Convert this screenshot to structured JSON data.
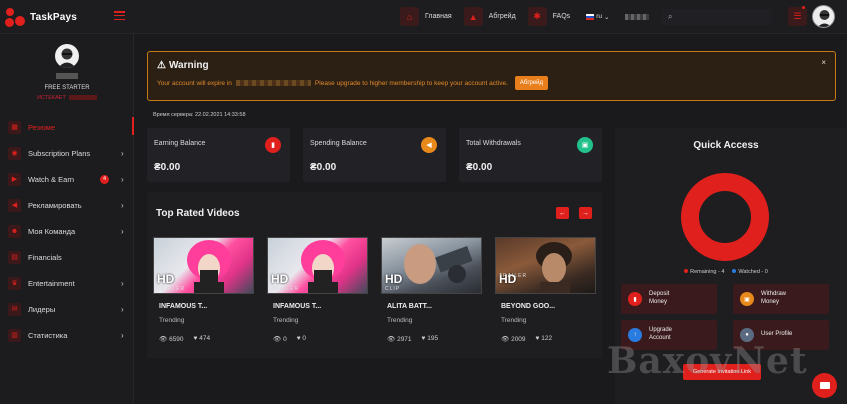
{
  "brand": {
    "name": "TaskPays"
  },
  "nav": {
    "items": [
      {
        "label": "Главная",
        "icon": "home-icon"
      },
      {
        "label": "Абгрейд",
        "icon": "upgrade-icon"
      },
      {
        "label": "FAQs",
        "icon": "faq-icon"
      }
    ],
    "language": "ru"
  },
  "profile": {
    "plan": "FREE STARTER",
    "expiry_label": "ИСТЕКАЕТ"
  },
  "sidebar": {
    "items": [
      {
        "label": "Резюме",
        "active": true
      },
      {
        "label": "Subscription Plans",
        "chevron": "›"
      },
      {
        "label": "Watch & Earn",
        "badge": "4",
        "chevron": "›"
      },
      {
        "label": "Рекламировать",
        "chevron": "›"
      },
      {
        "label": "Моя Команда",
        "chevron": "›"
      },
      {
        "label": "Financials"
      },
      {
        "label": "Entertainment",
        "chevron": "›"
      },
      {
        "label": "Лидеры",
        "chevron": "›"
      },
      {
        "label": "Статистика",
        "chevron": "›"
      }
    ]
  },
  "warning": {
    "title": "Warning",
    "text_before": "Your account will expire in",
    "text_after": "Please upgrade to higher membership to keep your account active.",
    "button": "Абгрейд",
    "close": "×"
  },
  "server_time": "Время сервера: 22.02.2021 14:33:58",
  "balances": [
    {
      "label": "Earning Balance",
      "value": "₴0.00",
      "icon_color": "#e0201c"
    },
    {
      "label": "Spending Balance",
      "value": "₴0.00",
      "icon_color": "#e8891c"
    },
    {
      "label": "Total Withdrawals",
      "value": "₴0.00",
      "icon_color": "#22c08a"
    }
  ],
  "top_rated": {
    "title": "Top Rated Videos",
    "prev": "←",
    "next": "→",
    "videos": [
      {
        "title": "INFAMOUS T...",
        "tag": "Trending",
        "views": "6590",
        "likes": "474",
        "badge": "HD",
        "sub": "TRAILER"
      },
      {
        "title": "INFAMOUS T...",
        "tag": "Trending",
        "views": "0",
        "likes": "0",
        "badge": "HD",
        "sub": "TRAILER"
      },
      {
        "title": "ALITA BATT...",
        "tag": "Trending",
        "views": "2971",
        "likes": "195",
        "badge": "HD",
        "sub": "CLIP"
      },
      {
        "title": "BEYOND GOO...",
        "tag": "Trending",
        "views": "2009",
        "likes": "122",
        "badge": "HD",
        "sub": "TRAILER"
      }
    ]
  },
  "quick_access": {
    "title": "Quick Access",
    "remaining_label": "Remaining - 4",
    "watched_label": "Watched - 0",
    "remaining": 4,
    "watched": 0,
    "buttons": [
      {
        "label": "Deposit Money",
        "icon_color": "#e0201c",
        "bg": "#3a1a1c"
      },
      {
        "label": "Withdraw Money",
        "icon_color": "#e8891c",
        "bg": "#3a1a1c"
      },
      {
        "label": "Upgrade Account",
        "icon_color": "#2a7be0",
        "bg": "#3a1a1c"
      },
      {
        "label": "User Profile",
        "icon_color": "#5a6a80",
        "bg": "#3a1a1c"
      }
    ],
    "invite": "Generate Invitation Link"
  },
  "colors": {
    "accent": "#e0201c",
    "warning": "#e08a2a",
    "watched": "#2a7be0"
  },
  "watermark": "BaxovNet"
}
